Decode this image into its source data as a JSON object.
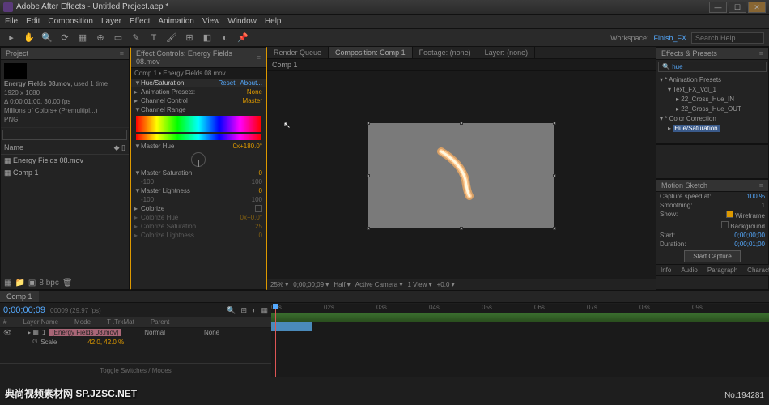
{
  "title": "Adobe After Effects - Untitled Project.aep *",
  "menu": [
    "File",
    "Edit",
    "Composition",
    "Layer",
    "Effect",
    "Animation",
    "View",
    "Window",
    "Help"
  ],
  "workspace": {
    "label": "Workspace:",
    "value": "Finish_FX"
  },
  "search_placeholder": "Search Help",
  "project": {
    "tab": "Project",
    "item_name": "Energy Fields 08.mov",
    "item_used": ", used 1 time",
    "res": "1920 x 1080",
    "dur": "Δ 0;00;01;00, 30.00 fps",
    "colors": "Millions of Colors+ (Premultipl...)",
    "codec": "PNG",
    "col_name": "Name",
    "rows": [
      "Energy Fields 08.mov",
      "Comp 1"
    ]
  },
  "effect": {
    "tab": "Effect Controls: Energy Fields 08.mov",
    "crumb": "Comp 1 • Energy Fields 08.mov",
    "fx_name": "Hue/Saturation",
    "reset": "Reset",
    "about": "About...",
    "rows": [
      {
        "lbl": "Animation Presets:",
        "val": "None"
      },
      {
        "lbl": "Channel Control",
        "val": "Master"
      },
      {
        "lbl": "Channel Range",
        "tri": "▼"
      },
      {
        "lbl": "Master Hue",
        "val": "0x+180.0°",
        "tri": "▼"
      },
      {
        "lbl": "Master Saturation",
        "val": "0",
        "tri": "▼",
        "range": [
          "-100",
          "100"
        ]
      },
      {
        "lbl": "Master Lightness",
        "val": "0",
        "tri": "▼",
        "range": [
          "-100",
          "100"
        ]
      },
      {
        "lbl": "Colorize",
        "check": false
      },
      {
        "lbl": "Colorize Hue",
        "val": "0x+0.0°",
        "dim": true
      },
      {
        "lbl": "Colorize Saturation",
        "val": "25",
        "dim": true
      },
      {
        "lbl": "Colorize Lightness",
        "val": "0",
        "dim": true
      }
    ]
  },
  "viewer": {
    "tabs": [
      {
        "lbl": "Render Queue"
      },
      {
        "lbl": "Composition: Comp 1",
        "active": true
      },
      {
        "lbl": "Footage: (none)"
      },
      {
        "lbl": "Layer: (none)"
      }
    ],
    "sub": "Comp 1",
    "status": [
      "25%",
      "0;00;00;09",
      "Half",
      "Active Camera",
      "1 View",
      "+0.0"
    ]
  },
  "effects_presets": {
    "tab": "Effects & Presets",
    "search": "hue",
    "tree": [
      {
        "t": "* Animation Presets",
        "d": 0
      },
      {
        "t": "Text_FX_Vol_1",
        "d": 1
      },
      {
        "t": "22_Cross_Hue_IN",
        "d": 2
      },
      {
        "t": "22_Cross_Hue_OUT",
        "d": 2
      },
      {
        "t": "* Color Correction",
        "d": 0
      },
      {
        "t": "Hue/Saturation",
        "d": 1,
        "hl": true
      }
    ]
  },
  "motion_sketch": {
    "tab": "Motion Sketch",
    "rows": [
      {
        "k": "Capture speed at:",
        "v": "100 %"
      },
      {
        "k": "Smoothing:",
        "v": "1"
      },
      {
        "k": "Show:",
        "v": "Wireframe",
        "chk": true
      },
      {
        "k": "",
        "v": "Background",
        "chk": false
      },
      {
        "k": "Start:",
        "v": "0;00;00;00"
      },
      {
        "k": "Duration:",
        "v": "0;00;01;00"
      }
    ],
    "btn": "Start Capture"
  },
  "mini": [
    "Info",
    "Audio",
    "Paragraph",
    "Character"
  ],
  "timeline": {
    "tab": "Comp 1",
    "tc": "0;00;00;09",
    "tc_sub": "00009 (29.97 fps)",
    "cols": [
      "#",
      "Layer Name",
      "Mode",
      "T .TrkMat",
      "Parent"
    ],
    "layer": {
      "num": "1",
      "name": "[Energy Fields 08.mov]",
      "mode": "Normal",
      "parent": "None"
    },
    "prop": {
      "name": "Scale",
      "val": "42.0, 42.0 %"
    },
    "marks": [
      "01s",
      "02s",
      "03s",
      "04s",
      "05s",
      "06s",
      "07s",
      "08s",
      "09s"
    ],
    "toggle": "Toggle Switches / Modes"
  },
  "watermark": "典尚视频素材网 SP.JZSC.NET",
  "wm_id": "No.194281"
}
